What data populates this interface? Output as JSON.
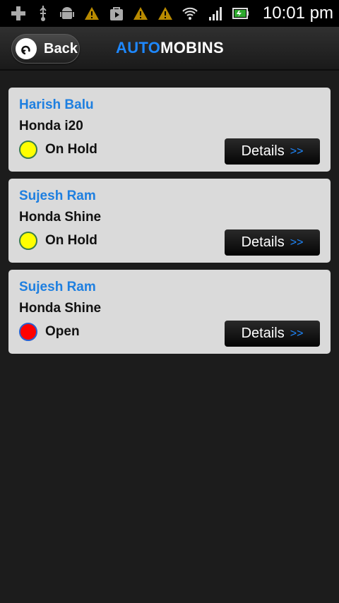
{
  "status_bar": {
    "left_icons": [
      "plus-icon",
      "usb-icon",
      "android-icon",
      "warning-icon",
      "play-store-icon",
      "warning-icon",
      "warning-icon"
    ],
    "right_icons": [
      "wifi-icon",
      "signal-icon",
      "battery-icon"
    ],
    "time": "10:01 pm"
  },
  "header": {
    "back_label": "Back",
    "title_part1": "AUTO",
    "title_part2": "MOBINS",
    "accent_color": "#1e88ff"
  },
  "cards": [
    {
      "name": "Harish Balu",
      "vehicle": "Honda i20",
      "status": "On Hold",
      "status_color": "#ffff00",
      "details_label": "Details",
      "details_arrow": ">>"
    },
    {
      "name": "Sujesh Ram",
      "vehicle": "Honda Shine",
      "status": "On Hold",
      "status_color": "#ffff00",
      "details_label": "Details",
      "details_arrow": ">>"
    },
    {
      "name": "Sujesh Ram",
      "vehicle": "Honda Shine",
      "status": "Open",
      "status_color": "#ff0000",
      "details_label": "Details",
      "details_arrow": ">>"
    }
  ]
}
